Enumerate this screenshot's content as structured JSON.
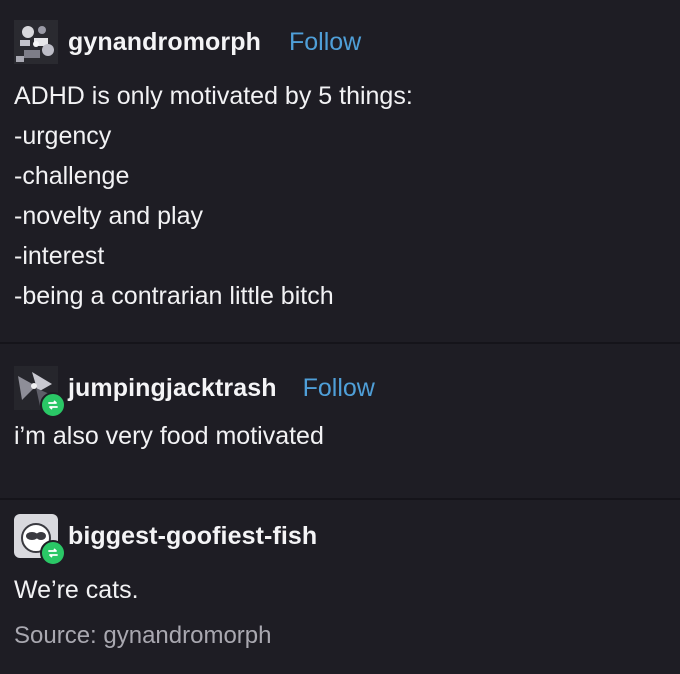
{
  "posts": [
    {
      "username": "gynandromorph",
      "follow_label": "Follow",
      "lines": [
        "ADHD is only motivated by 5 things:",
        "-urgency",
        "-challenge",
        "-novelty and play",
        "-interest",
        "-being a contrarian little bitch"
      ]
    },
    {
      "username": "jumpingjacktrash",
      "follow_label": "Follow",
      "lines": [
        "i’m also very food motivated"
      ]
    },
    {
      "username": "biggest-goofiest-fish",
      "lines": [
        "We’re cats."
      ]
    }
  ],
  "source_label": "Source: gynandromorph",
  "colors": {
    "background": "#1e1d24",
    "follow": "#4f9fd8",
    "reblog_badge": "#2ac766",
    "source": "#a9a8b0"
  }
}
